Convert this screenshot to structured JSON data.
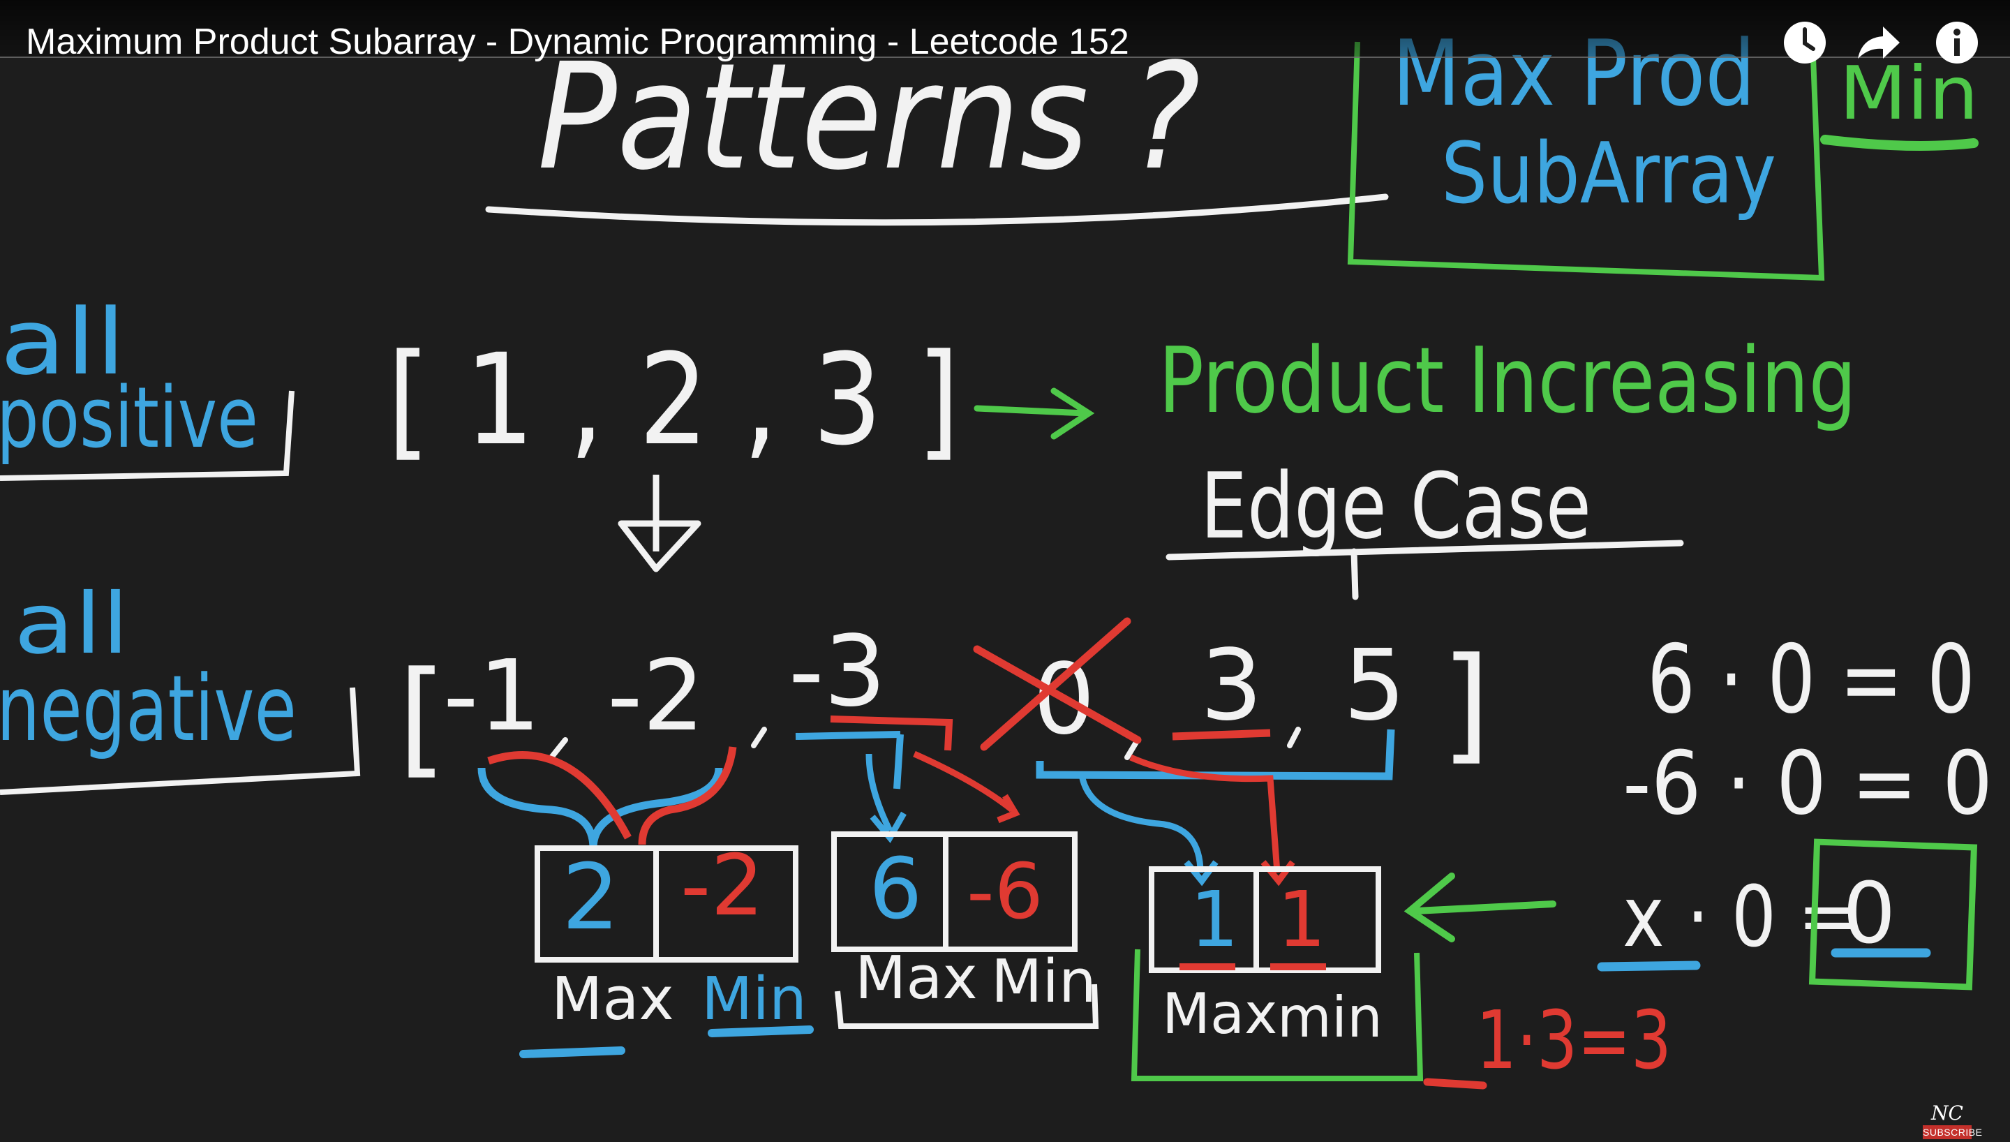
{
  "video": {
    "title": "Maximum Product Subarray - Dynamic Programming - Leetcode 152"
  },
  "top_icons": [
    "watch-later-icon",
    "share-icon",
    "info-icon"
  ],
  "colors": {
    "background": "#1d1d1d",
    "chalk_white": "#f2f2f2",
    "blue": "#3ea6e0",
    "green": "#4fc94a",
    "red": "#e03a32"
  },
  "board": {
    "heading": "Patterns ?",
    "box_title_line1": "Max Prod",
    "box_title_line2": "SubArray",
    "min_label": "Min",
    "all_positive_line1": "all",
    "all_positive_line2": "positive",
    "positive_array": "[ 1 , 2 , 3 ]",
    "product_increasing": "Product Increasing",
    "edge_case": "Edge Case",
    "all_negative_line1": "all",
    "all_negative_line2": "negative",
    "negative_array": {
      "open": "[",
      "items": [
        "-1",
        "-2",
        "-3",
        "0",
        "3",
        "5"
      ],
      "close": "]"
    },
    "cells": [
      {
        "max": "2",
        "min": "-2",
        "max_label": "Max",
        "min_label": "Min"
      },
      {
        "max": "6",
        "min": "-6",
        "max_label": "Max",
        "min_label": "Min"
      },
      {
        "max": "1",
        "min": "1",
        "max_label": "Max",
        "min_label": "min"
      }
    ],
    "eq1": "6 · 0 = 0",
    "eq2": "-6 · 0 = 0",
    "eq3_x": "x · 0",
    "eq3_eq": "=",
    "eq3_zero": "0",
    "eq4": "1·3=3"
  },
  "logo": {
    "mark": "NC",
    "subscribe": "SUBSCRIBE"
  }
}
